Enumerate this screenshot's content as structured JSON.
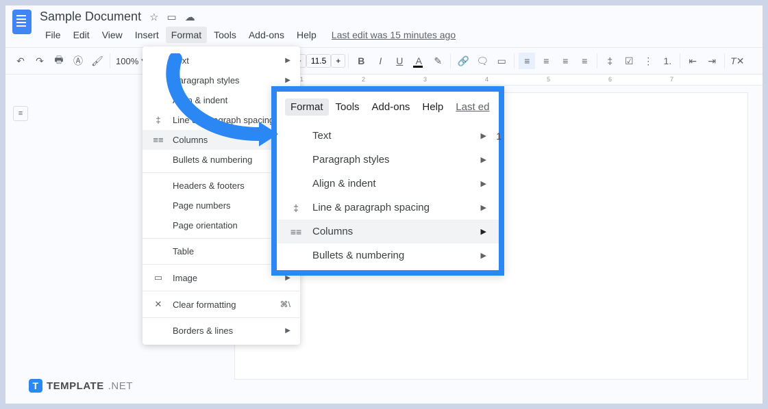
{
  "header": {
    "title": "Sample Document",
    "star_icon": "☆",
    "move_icon": "▭",
    "cloud_icon": "☁"
  },
  "menu": {
    "file": "File",
    "edit": "Edit",
    "view": "View",
    "insert": "Insert",
    "format": "Format",
    "tools": "Tools",
    "addons": "Add-ons",
    "help": "Help",
    "last_edit": "Last edit was 15 minutes ago"
  },
  "toolbar": {
    "zoom": "100%",
    "font_size": "11.5",
    "minus": "−",
    "plus": "+"
  },
  "dropdown": {
    "items": [
      {
        "icon": "",
        "label": "Text",
        "arrow": true
      },
      {
        "icon": "",
        "label": "Paragraph styles",
        "arrow": true
      },
      {
        "icon": "",
        "label": "Align & indent",
        "arrow": true
      },
      {
        "icon": "‡",
        "label": "Line & paragraph spacing",
        "arrow": true
      },
      {
        "icon": "≡≡",
        "label": "Columns",
        "arrow": true,
        "highlighted": true
      },
      {
        "icon": "",
        "label": "Bullets & numbering",
        "arrow": true
      },
      {
        "sep": true
      },
      {
        "icon": "",
        "label": "Headers & footers"
      },
      {
        "icon": "",
        "label": "Page numbers"
      },
      {
        "icon": "",
        "label": "Page orientation"
      },
      {
        "sep": true
      },
      {
        "icon": "",
        "label": "Table",
        "arrow": true
      },
      {
        "sep": true
      },
      {
        "icon": "▭",
        "label": "Image",
        "arrow": true
      },
      {
        "sep": true
      },
      {
        "icon": "✕",
        "label": "Clear formatting",
        "shortcut": "⌘\\"
      },
      {
        "sep": true
      },
      {
        "icon": "",
        "label": "Borders & lines",
        "arrow": true
      }
    ]
  },
  "callout": {
    "menu": {
      "format": "Format",
      "tools": "Tools",
      "addons": "Add-ons",
      "help": "Help",
      "last_edit": "Last ed"
    },
    "items": [
      {
        "icon": "",
        "label": "Text",
        "arrow": true,
        "trailing": "1"
      },
      {
        "icon": "",
        "label": "Paragraph styles",
        "arrow": true
      },
      {
        "icon": "",
        "label": "Align & indent",
        "arrow": true
      },
      {
        "icon": "‡",
        "label": "Line & paragraph spacing",
        "arrow": true
      },
      {
        "icon": "≡≡",
        "label": "Columns",
        "arrow": true,
        "highlighted": true
      },
      {
        "icon": "",
        "label": "Bullets & numbering",
        "arrow": true
      }
    ]
  },
  "ruler": {
    "marks": [
      "1",
      "2",
      "3",
      "4",
      "5",
      "6",
      "7"
    ]
  },
  "watermark": {
    "brand": "TEMPLATE",
    "suffix": ".NET"
  }
}
